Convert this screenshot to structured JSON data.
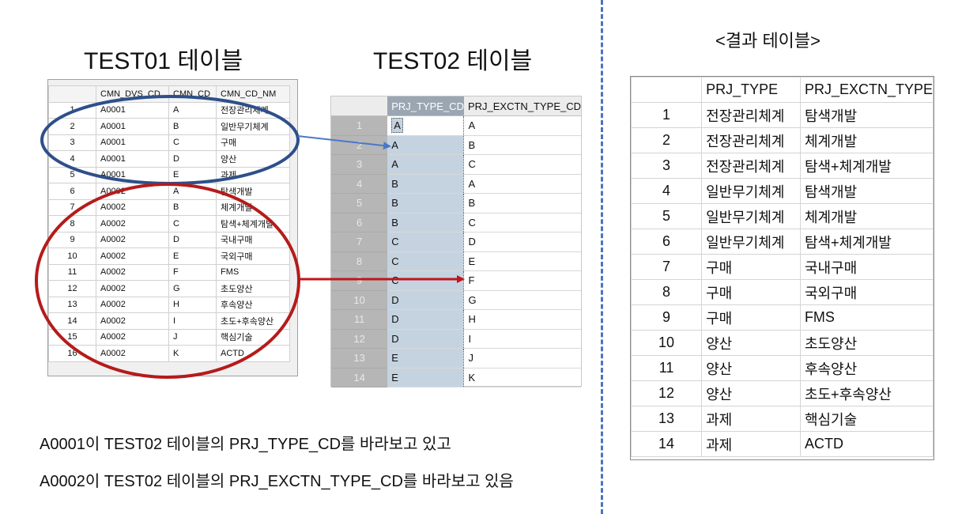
{
  "titles": {
    "test01": "TEST01 테이블",
    "test02": "TEST02 테이블",
    "result": "<결과 테이블>"
  },
  "notes": {
    "line1": "A0001이 TEST02 테이블의 PRJ_TYPE_CD를 바라보고 있고",
    "line2": "A0002이 TEST02 테이블의 PRJ_EXCTN_TYPE_CD를 바라보고 있음"
  },
  "test01": {
    "headers": [
      "",
      "CMN_DVS_CD",
      "CMN_CD",
      "CMN_CD_NM"
    ],
    "rows": [
      [
        "1",
        "A0001",
        "A",
        "전장관리체계"
      ],
      [
        "2",
        "A0001",
        "B",
        "일반무기체계"
      ],
      [
        "3",
        "A0001",
        "C",
        "구매"
      ],
      [
        "4",
        "A0001",
        "D",
        "양산"
      ],
      [
        "5",
        "A0001",
        "E",
        "과제"
      ],
      [
        "6",
        "A0002",
        "A",
        "탐색개발"
      ],
      [
        "7",
        "A0002",
        "B",
        "체계개발"
      ],
      [
        "8",
        "A0002",
        "C",
        "탐색+체계개발"
      ],
      [
        "9",
        "A0002",
        "D",
        "국내구매"
      ],
      [
        "10",
        "A0002",
        "E",
        "국외구매"
      ],
      [
        "11",
        "A0002",
        "F",
        "FMS"
      ],
      [
        "12",
        "A0002",
        "G",
        "초도양산"
      ],
      [
        "13",
        "A0002",
        "H",
        "후속양산"
      ],
      [
        "14",
        "A0002",
        "I",
        "초도+후속양산"
      ],
      [
        "15",
        "A0002",
        "J",
        "핵심기술"
      ],
      [
        "16",
        "A0002",
        "K",
        "ACTD"
      ]
    ]
  },
  "test02": {
    "headers": [
      "",
      "PRJ_TYPE_CD",
      "PRJ_EXCTN_TYPE_CD"
    ],
    "rows": [
      [
        "1",
        "A",
        "A"
      ],
      [
        "2",
        "A",
        "B"
      ],
      [
        "3",
        "A",
        "C"
      ],
      [
        "4",
        "B",
        "A"
      ],
      [
        "5",
        "B",
        "B"
      ],
      [
        "6",
        "B",
        "C"
      ],
      [
        "7",
        "C",
        "D"
      ],
      [
        "8",
        "C",
        "E"
      ],
      [
        "9",
        "C",
        "F"
      ],
      [
        "10",
        "D",
        "G"
      ],
      [
        "11",
        "D",
        "H"
      ],
      [
        "12",
        "D",
        "I"
      ],
      [
        "13",
        "E",
        "J"
      ],
      [
        "14",
        "E",
        "K"
      ]
    ]
  },
  "result": {
    "headers": [
      "",
      "PRJ_TYPE",
      "PRJ_EXCTN_TYPE"
    ],
    "rows": [
      [
        "1",
        "전장관리체계",
        "탐색개발"
      ],
      [
        "2",
        "전장관리체계",
        "체계개발"
      ],
      [
        "3",
        "전장관리체계",
        "탐색+체계개발"
      ],
      [
        "4",
        "일반무기체계",
        "탐색개발"
      ],
      [
        "5",
        "일반무기체계",
        "체계개발"
      ],
      [
        "6",
        "일반무기체계",
        "탐색+체계개발"
      ],
      [
        "7",
        "구매",
        "국내구매"
      ],
      [
        "8",
        "구매",
        "국외구매"
      ],
      [
        "9",
        "구매",
        "FMS"
      ],
      [
        "10",
        "양산",
        "초도양산"
      ],
      [
        "11",
        "양산",
        "후속양산"
      ],
      [
        "12",
        "양산",
        "초도+후속양산"
      ],
      [
        "13",
        "과제",
        "핵심기술"
      ],
      [
        "14",
        "과제",
        "ACTD"
      ]
    ]
  },
  "colors": {
    "blue_ellipse": "#2e4f8a",
    "red_ellipse": "#b51b1b",
    "blue_arrow": "#4a78c8",
    "red_arrow": "#c0161b",
    "divider": "#4a74c4",
    "selected_column": "#c5d3e0"
  }
}
